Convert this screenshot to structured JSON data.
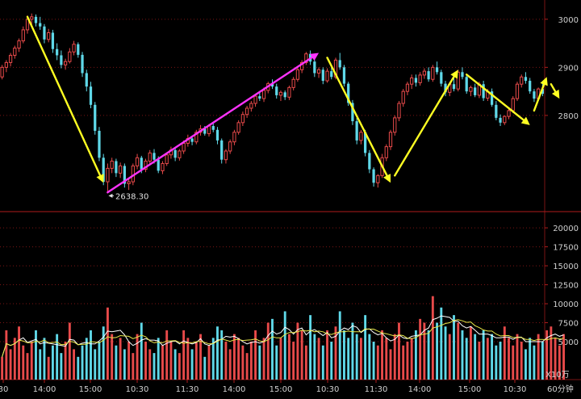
{
  "chart_data": [
    {
      "type": "candlestick",
      "panel": "price",
      "title": "",
      "y_axis_ticks": [
        3000,
        2900,
        2800
      ],
      "ylim": [
        2600,
        3040
      ],
      "low_marker_label": "2638.30",
      "bar_count": 134,
      "colors": {
        "up": "#e84a4a",
        "down": "#5fd8e8",
        "background": "#000000",
        "grid": "#7a1414"
      },
      "candles": [
        [
          2880,
          2905,
          2875,
          2900
        ],
        [
          2900,
          2915,
          2890,
          2910
        ],
        [
          2910,
          2930,
          2902,
          2925
        ],
        [
          2925,
          2945,
          2918,
          2940
        ],
        [
          2940,
          2960,
          2932,
          2955
        ],
        [
          2955,
          2985,
          2950,
          2978
        ],
        [
          2978,
          3008,
          2970,
          3000
        ],
        [
          3000,
          3012,
          2988,
          3005
        ],
        [
          3005,
          3010,
          2985,
          2992
        ],
        [
          2992,
          3005,
          2978,
          2985
        ],
        [
          2985,
          2990,
          2950,
          2958
        ],
        [
          2958,
          2980,
          2952,
          2972
        ],
        [
          2972,
          2978,
          2930,
          2938
        ],
        [
          2938,
          2950,
          2915,
          2925
        ],
        [
          2925,
          2935,
          2898,
          2905
        ],
        [
          2905,
          2918,
          2895,
          2912
        ],
        [
          2912,
          2940,
          2908,
          2932
        ],
        [
          2932,
          2955,
          2925,
          2948
        ],
        [
          2948,
          2952,
          2920,
          2926
        ],
        [
          2926,
          2932,
          2880,
          2888
        ],
        [
          2888,
          2895,
          2850,
          2860
        ],
        [
          2860,
          2870,
          2815,
          2822
        ],
        [
          2822,
          2828,
          2760,
          2768
        ],
        [
          2768,
          2776,
          2705,
          2712
        ],
        [
          2712,
          2720,
          2655,
          2662
        ],
        [
          2662,
          2700,
          2638,
          2690
        ],
        [
          2690,
          2712,
          2680,
          2705
        ],
        [
          2705,
          2710,
          2672,
          2680
        ],
        [
          2680,
          2702,
          2670,
          2695
        ],
        [
          2695,
          2700,
          2650,
          2658
        ],
        [
          2658,
          2668,
          2645,
          2662
        ],
        [
          2662,
          2700,
          2655,
          2695
        ],
        [
          2695,
          2720,
          2688,
          2712
        ],
        [
          2712,
          2716,
          2680,
          2688
        ],
        [
          2688,
          2710,
          2682,
          2705
        ],
        [
          2705,
          2728,
          2698,
          2722
        ],
        [
          2722,
          2730,
          2700,
          2708
        ],
        [
          2708,
          2715,
          2680,
          2685
        ],
        [
          2685,
          2705,
          2678,
          2700
        ],
        [
          2700,
          2722,
          2695,
          2718
        ],
        [
          2718,
          2735,
          2710,
          2728
        ],
        [
          2728,
          2732,
          2705,
          2712
        ],
        [
          2712,
          2730,
          2706,
          2726
        ],
        [
          2726,
          2748,
          2720,
          2742
        ],
        [
          2742,
          2760,
          2735,
          2752
        ],
        [
          2752,
          2758,
          2738,
          2745
        ],
        [
          2745,
          2770,
          2740,
          2765
        ],
        [
          2765,
          2780,
          2758,
          2772
        ],
        [
          2772,
          2778,
          2758,
          2762
        ],
        [
          2762,
          2782,
          2756,
          2778
        ],
        [
          2778,
          2785,
          2765,
          2770
        ],
        [
          2770,
          2776,
          2740,
          2748
        ],
        [
          2748,
          2752,
          2700,
          2708
        ],
        [
          2708,
          2730,
          2700,
          2726
        ],
        [
          2726,
          2750,
          2720,
          2745
        ],
        [
          2745,
          2770,
          2738,
          2765
        ],
        [
          2765,
          2790,
          2760,
          2785
        ],
        [
          2785,
          2808,
          2778,
          2802
        ],
        [
          2802,
          2820,
          2795,
          2815
        ],
        [
          2815,
          2830,
          2808,
          2825
        ],
        [
          2825,
          2845,
          2818,
          2840
        ],
        [
          2840,
          2848,
          2830,
          2835
        ],
        [
          2835,
          2858,
          2828,
          2852
        ],
        [
          2852,
          2870,
          2846,
          2866
        ],
        [
          2866,
          2875,
          2855,
          2860
        ],
        [
          2860,
          2866,
          2835,
          2842
        ],
        [
          2842,
          2852,
          2830,
          2848
        ],
        [
          2848,
          2852,
          2832,
          2838
        ],
        [
          2838,
          2862,
          2832,
          2858
        ],
        [
          2858,
          2880,
          2852,
          2875
        ],
        [
          2875,
          2900,
          2870,
          2895
        ],
        [
          2895,
          2915,
          2888,
          2910
        ],
        [
          2910,
          2932,
          2905,
          2928
        ],
        [
          2928,
          2935,
          2905,
          2912
        ],
        [
          2912,
          2916,
          2880,
          2888
        ],
        [
          2888,
          2900,
          2878,
          2895
        ],
        [
          2895,
          2900,
          2865,
          2872
        ],
        [
          2872,
          2898,
          2868,
          2892
        ],
        [
          2892,
          2905,
          2875,
          2880
        ],
        [
          2880,
          2920,
          2875,
          2915
        ],
        [
          2915,
          2930,
          2895,
          2900
        ],
        [
          2900,
          2905,
          2860,
          2866
        ],
        [
          2866,
          2870,
          2820,
          2826
        ],
        [
          2826,
          2832,
          2780,
          2788
        ],
        [
          2788,
          2795,
          2740,
          2748
        ],
        [
          2748,
          2770,
          2740,
          2765
        ],
        [
          2765,
          2770,
          2715,
          2722
        ],
        [
          2722,
          2728,
          2680,
          2688
        ],
        [
          2688,
          2692,
          2652,
          2660
        ],
        [
          2660,
          2678,
          2650,
          2675
        ],
        [
          2675,
          2720,
          2670,
          2712
        ],
        [
          2712,
          2740,
          2705,
          2735
        ],
        [
          2735,
          2770,
          2728,
          2765
        ],
        [
          2765,
          2800,
          2758,
          2795
        ],
        [
          2795,
          2830,
          2788,
          2825
        ],
        [
          2825,
          2855,
          2818,
          2850
        ],
        [
          2850,
          2870,
          2842,
          2865
        ],
        [
          2865,
          2885,
          2855,
          2878
        ],
        [
          2878,
          2885,
          2860,
          2868
        ],
        [
          2868,
          2890,
          2862,
          2884
        ],
        [
          2884,
          2898,
          2876,
          2892
        ],
        [
          2892,
          2900,
          2870,
          2875
        ],
        [
          2875,
          2905,
          2870,
          2900
        ],
        [
          2900,
          2912,
          2885,
          2890
        ],
        [
          2890,
          2895,
          2860,
          2866
        ],
        [
          2866,
          2872,
          2840,
          2848
        ],
        [
          2848,
          2870,
          2840,
          2865
        ],
        [
          2865,
          2878,
          2850,
          2855
        ],
        [
          2855,
          2895,
          2850,
          2890
        ],
        [
          2890,
          2900,
          2875,
          2880
        ],
        [
          2880,
          2884,
          2845,
          2850
        ],
        [
          2850,
          2862,
          2840,
          2858
        ],
        [
          2858,
          2866,
          2838,
          2842
        ],
        [
          2842,
          2870,
          2836,
          2865
        ],
        [
          2865,
          2872,
          2830,
          2836
        ],
        [
          2836,
          2855,
          2830,
          2850
        ],
        [
          2850,
          2856,
          2818,
          2822
        ],
        [
          2822,
          2830,
          2790,
          2795
        ],
        [
          2795,
          2802,
          2778,
          2785
        ],
        [
          2785,
          2800,
          2780,
          2798
        ],
        [
          2798,
          2815,
          2792,
          2810
        ],
        [
          2810,
          2840,
          2805,
          2835
        ],
        [
          2835,
          2870,
          2830,
          2865
        ],
        [
          2865,
          2885,
          2858,
          2880
        ],
        [
          2880,
          2890,
          2866,
          2872
        ],
        [
          2872,
          2878,
          2845,
          2850
        ],
        [
          2850,
          2855,
          2828,
          2835
        ],
        [
          2835,
          2858,
          2830,
          2855
        ],
        [
          2855,
          2866,
          2840,
          2845
        ]
      ],
      "trend_arrows": [
        {
          "color": "yellow",
          "from_bar": 6,
          "from_price": 3005,
          "to_bar": 24,
          "to_price": 2660
        },
        {
          "color": "magenta",
          "from_bar": 25,
          "from_price": 2640,
          "to_bar": 75,
          "to_price": 2930
        },
        {
          "color": "yellow",
          "from_bar": 77,
          "from_price": 2920,
          "to_bar": 92,
          "to_price": 2660
        },
        {
          "color": "yellow",
          "from_bar": 93,
          "from_price": 2675,
          "to_bar": 108,
          "to_price": 2895
        },
        {
          "color": "yellow",
          "from_bar": 110,
          "from_price": 2885,
          "to_bar": 125,
          "to_price": 2780
        },
        {
          "color": "yellow",
          "from_bar": 126,
          "from_price": 2810,
          "to_bar": 129,
          "to_price": 2880
        },
        {
          "color": "yellow",
          "from_bar": 130,
          "from_price": 2865,
          "to_bar": 132,
          "to_price": 2835
        }
      ]
    },
    {
      "type": "bar",
      "panel": "volume",
      "y_axis_ticks": [
        20000,
        17500,
        15000,
        12500,
        10000,
        7500,
        5000
      ],
      "ylim": [
        0,
        21500
      ],
      "multiplier_label": "X10万",
      "values": [
        3000,
        6500,
        4000,
        5500,
        7000,
        4500,
        3500,
        5000,
        6500,
        4000,
        5500,
        3000,
        4500,
        6000,
        3500,
        5000,
        7500,
        4000,
        3000,
        4500,
        5500,
        6500,
        4000,
        5000,
        7000,
        9500,
        6000,
        4500,
        5500,
        4000,
        5000,
        3500,
        6000,
        7500,
        5000,
        4000,
        3500,
        5500,
        4500,
        6500,
        5000,
        4000,
        3500,
        6500,
        5500,
        4000,
        5000,
        6000,
        3000,
        4500,
        5500,
        7000,
        6500,
        5000,
        4000,
        6000,
        5500,
        4500,
        3500,
        5000,
        6500,
        4500,
        5500,
        7500,
        8000,
        4500,
        5500,
        9000,
        6000,
        5000,
        7500,
        6500,
        4500,
        8500,
        6000,
        5500,
        4500,
        6500,
        5000,
        7000,
        9000,
        6500,
        5500,
        7500,
        6000,
        5500,
        8500,
        6000,
        5000,
        4500,
        6500,
        5500,
        4000,
        6000,
        7500,
        4500,
        5000,
        5500,
        6500,
        8000,
        7500,
        6500,
        11000,
        7500,
        9500,
        7000,
        6000,
        8500,
        7500,
        6500,
        5500,
        7000,
        6000,
        5000,
        6500,
        5500,
        6000,
        4500,
        5000,
        7000,
        5500,
        4500,
        6000,
        5000,
        4000,
        5500,
        4500,
        6000,
        5000,
        6500,
        7000,
        5500,
        4500,
        6000
      ],
      "ma_lines": [
        {
          "color": "#ffffff",
          "period": 5
        },
        {
          "color": "#e8e84a",
          "period": 10
        }
      ]
    }
  ],
  "x_axis": {
    "labels": [
      "30",
      "14:00",
      "15:00",
      "10:30",
      "11:30",
      "14:00",
      "15:00",
      "10:30",
      "11:30",
      "14:00",
      "15:00",
      "10:30"
    ],
    "period_label": "60分钟"
  }
}
